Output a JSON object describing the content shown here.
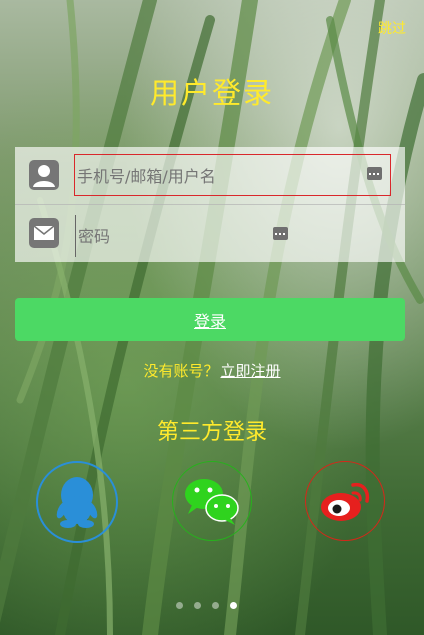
{
  "header": {
    "skip_label": "跳过",
    "title": "用户登录"
  },
  "form": {
    "username_placeholder": "手机号/邮箱/用户名",
    "password_placeholder": "密码"
  },
  "login_button_label": "登录",
  "register": {
    "question": "没有账号？",
    "link_label": "立即注册"
  },
  "third_party": {
    "title": "第三方登录",
    "icons": [
      "qq-icon",
      "wechat-icon",
      "weibo-icon"
    ]
  },
  "pager": {
    "total": 4,
    "active_index": 3
  },
  "colors": {
    "accent_yellow": "#ffea2c",
    "login_green": "#4cd964",
    "qq_blue": "#2a8fd8",
    "wechat_green": "#27b11d",
    "weibo_red": "#d4281a"
  }
}
